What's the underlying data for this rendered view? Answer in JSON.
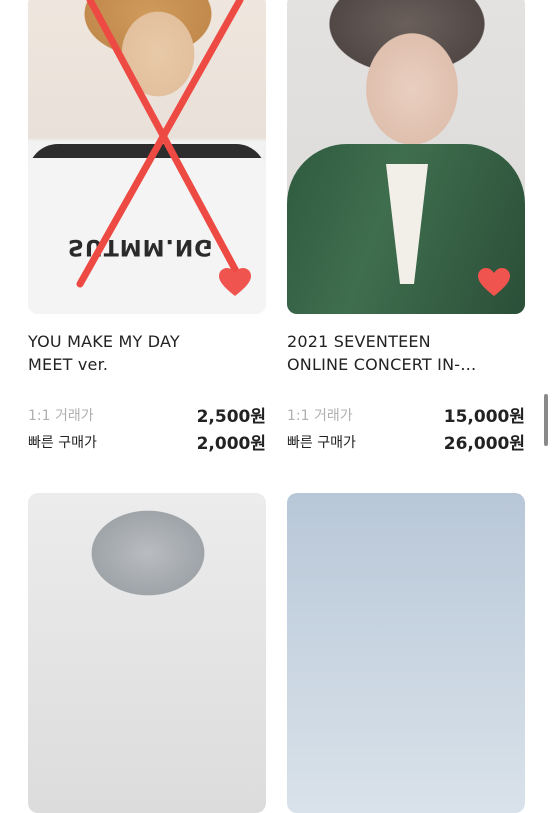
{
  "products": [
    {
      "title": [
        "YOU MAKE MY DAY",
        "MEET ver."
      ],
      "one_to_one_label": "1:1 거래가",
      "one_to_one_price": "2,500원",
      "quick_label": "빠른 구매가",
      "quick_price": "2,000원",
      "favorited": true,
      "crossed_out": true,
      "shirt_text": "SUTMM.NG"
    },
    {
      "title": [
        "2021 SEVENTEEN",
        "ONLINE CONCERT IN-…"
      ],
      "one_to_one_label": "1:1 거래가",
      "one_to_one_price": "15,000원",
      "quick_label": "빠른 구매가",
      "quick_price": "26,000원",
      "favorited": true,
      "crossed_out": false
    }
  ],
  "colors": {
    "heart": "#f0544f",
    "cross": "#ee4a44",
    "scrollbar": "#8a8a8a"
  }
}
